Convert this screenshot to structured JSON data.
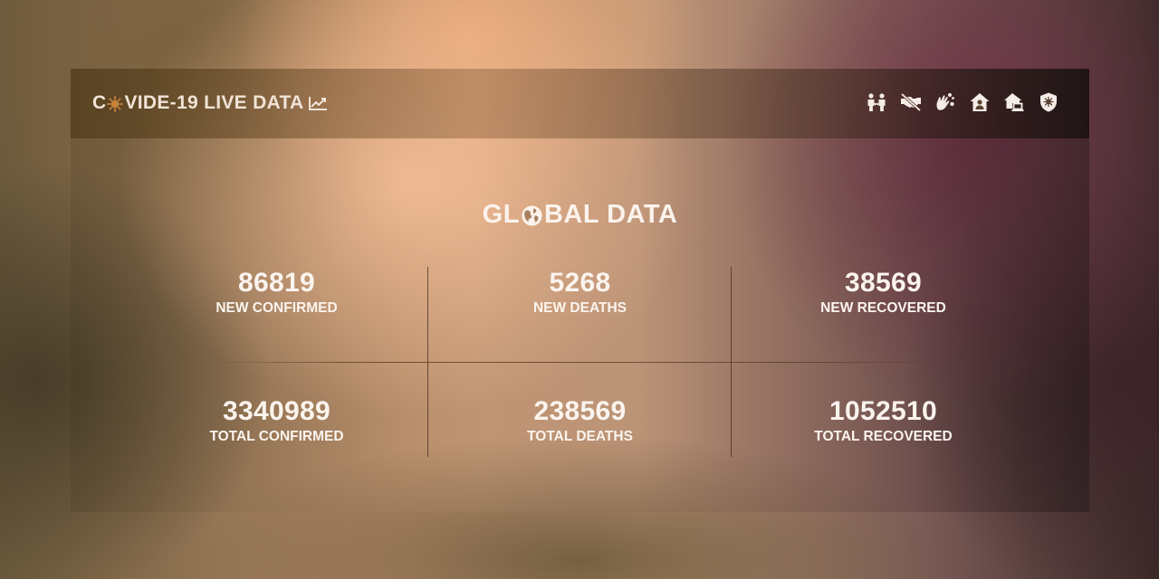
{
  "brand": {
    "prefix": "C",
    "suffix": "VIDE-19 LIVE DATA",
    "virus_icon": "virus-icon",
    "trend_icon": "chart-line-icon"
  },
  "nav_icons": [
    "people-distance-icon",
    "no-handshake-icon",
    "hand-wash-icon",
    "house-user-icon",
    "house-laptop-icon",
    "shield-virus-icon"
  ],
  "section": {
    "title_prefix": "GL",
    "title_suffix": "BAL DATA",
    "globe_icon": "globe-icon"
  },
  "stats": {
    "new_confirmed": {
      "value": "86819",
      "label": "NEW CONFIRMED"
    },
    "new_deaths": {
      "value": "5268",
      "label": "NEW DEATHS"
    },
    "new_recovered": {
      "value": "38569",
      "label": "NEW RECOVERED"
    },
    "total_confirmed": {
      "value": "3340989",
      "label": "TOTAL CONFIRMED"
    },
    "total_deaths": {
      "value": "238569",
      "label": "TOTAL DEATHS"
    },
    "total_recovered": {
      "value": "1052510",
      "label": "TOTAL RECOVERED"
    }
  },
  "colors": {
    "text": "#fbf4ee",
    "accent_virus": "#c8823a",
    "divider": "#5a3c28"
  }
}
